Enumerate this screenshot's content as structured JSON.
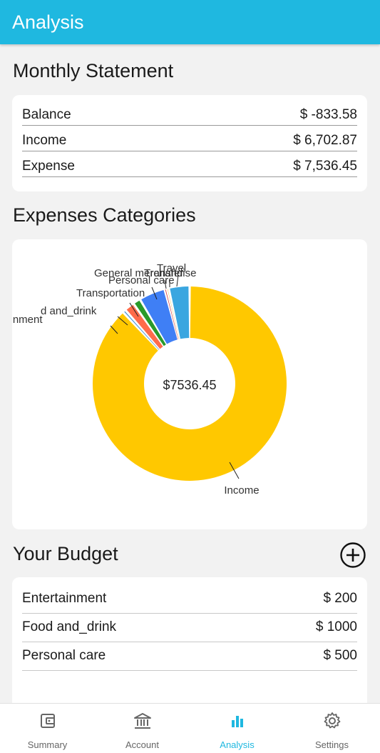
{
  "appbar": {
    "title": "Analysis"
  },
  "monthly": {
    "title": "Monthly Statement",
    "rows": [
      {
        "label": "Balance",
        "value": "$ -833.58"
      },
      {
        "label": "Income",
        "value": "$ 6,702.87"
      },
      {
        "label": "Expense",
        "value": "$ 7,536.45"
      }
    ]
  },
  "expenses": {
    "title": "Expenses Categories",
    "center_label": "$7536.45"
  },
  "chart_data": {
    "type": "pie",
    "center_label": "$7536.45",
    "categories": [
      "Income",
      "Entertainment",
      "Food and_drink",
      "Transportation",
      "Personal care",
      "General merchandise",
      "Transfer",
      "Travel"
    ],
    "values": [
      6283,
      38,
      120,
      90,
      310,
      20,
      30,
      246
    ],
    "colors": [
      "#ffc800",
      "#3a8fd8",
      "#ff6b4a",
      "#2a9a2a",
      "#3f7ff5",
      "#d84343",
      "#f0a800",
      "#3aa6e0"
    ],
    "labels_visible": [
      "Income",
      "rtainment",
      "d and_drink",
      "Transportation",
      "Personal care",
      "General merchandise",
      "Transfer",
      "Travel"
    ]
  },
  "budget": {
    "title": "Your Budget",
    "items": [
      {
        "label": "Entertainment",
        "value": "$ 200"
      },
      {
        "label": "Food and_drink",
        "value": "$ 1000"
      },
      {
        "label": "Personal care",
        "value": "$ 500"
      }
    ]
  },
  "nav": [
    {
      "label": "Summary",
      "icon": "wallet-icon"
    },
    {
      "label": "Account",
      "icon": "bank-icon"
    },
    {
      "label": "Analysis",
      "icon": "bar-chart-icon",
      "active": true
    },
    {
      "label": "Settings",
      "icon": "gear-icon"
    }
  ],
  "colors": {
    "accent": "#1fb8e0",
    "inactive": "#666666"
  }
}
